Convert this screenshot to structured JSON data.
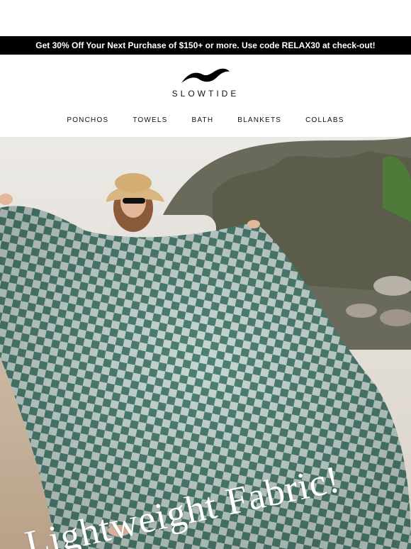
{
  "promo": {
    "text": "Get 30% Off Your Next Purchase of $150+ or more. Use code RELAX30 at check-out!"
  },
  "brand": {
    "name": "SLOWTIDE"
  },
  "nav": {
    "items": [
      {
        "label": "PONCHOS"
      },
      {
        "label": "TOWELS"
      },
      {
        "label": "BATH"
      },
      {
        "label": "BLANKETS"
      },
      {
        "label": "COLLABS"
      }
    ]
  },
  "hero": {
    "title": "Lightweight Fabric!",
    "colors": {
      "check_dark": "#4f7f74",
      "check_light": "#c7d8d2",
      "sky": "#e9e6e1",
      "sand": "#cdbaa4"
    }
  }
}
